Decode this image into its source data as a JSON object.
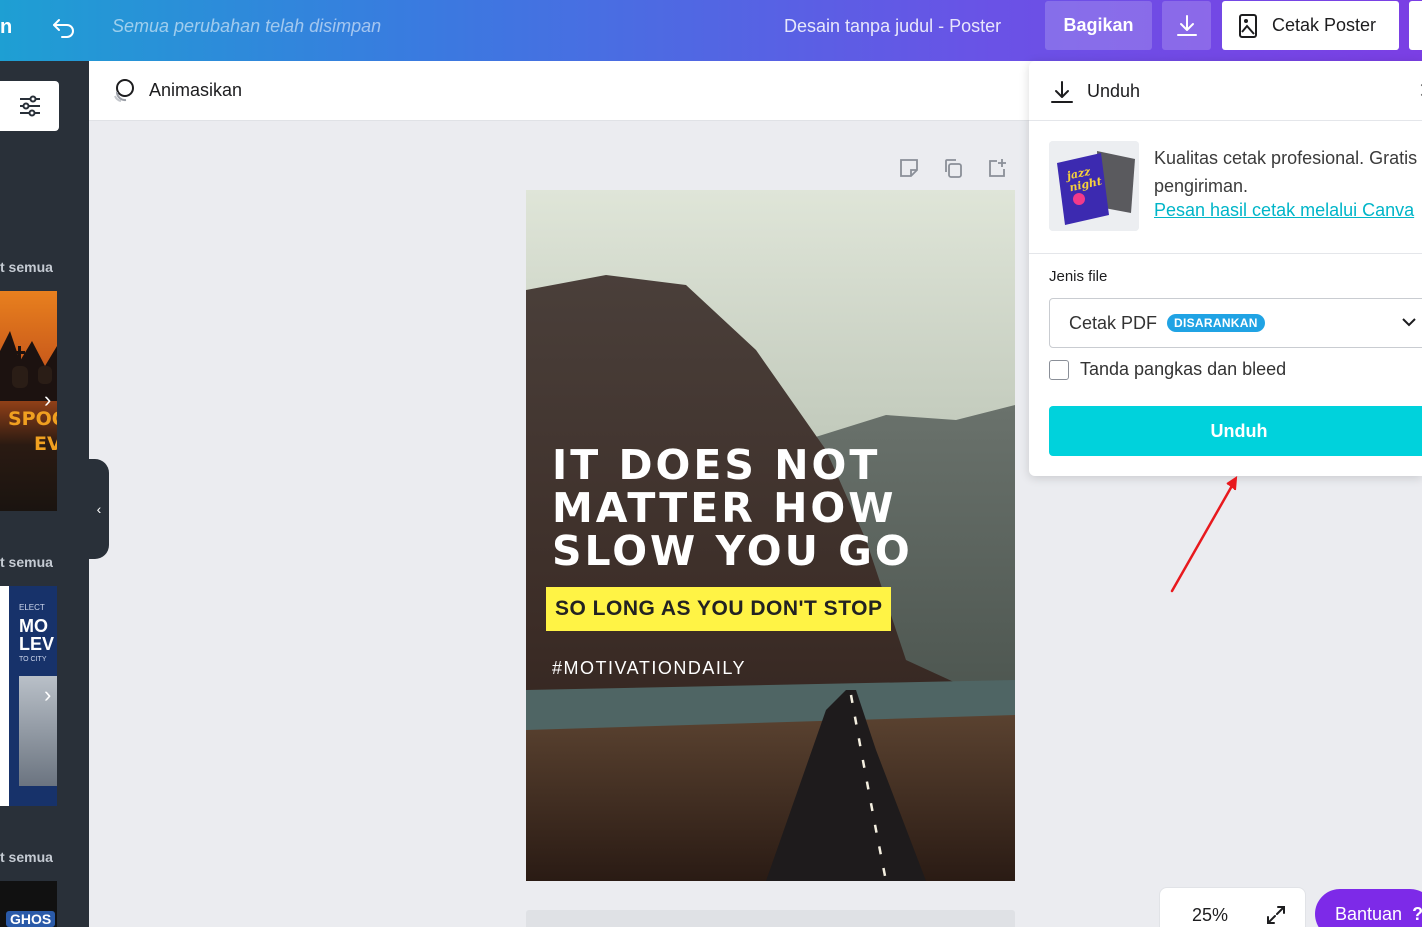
{
  "topbar": {
    "edge_text": "n",
    "saved_status": "Semua perubahan telah disimpan",
    "doc_title": "Desain tanpa judul - Poster",
    "share_label": "Bagikan",
    "print_label": "Cetak Poster"
  },
  "leftpanel": {
    "see_all_1": "t semua",
    "see_all_2": "t semua",
    "see_all_3": "t semua",
    "thumb1_text": "SPOO",
    "thumb1_text2": "EV",
    "thumb2_text_a": "ELECT",
    "thumb2_text_b": "MO",
    "thumb2_text_c": "LEV",
    "thumb2_text_d": "TO CITY",
    "thumb3_text": "GHOS"
  },
  "toolbar": {
    "animate_label": "Animasikan"
  },
  "poster": {
    "headline_1": "IT DOES NOT",
    "headline_2": "MATTER HOW",
    "headline_3": "SLOW YOU GO",
    "subline": "SO LONG AS YOU DON'T STOP",
    "hashtag": "#MOTIVATIONDAILY"
  },
  "download_panel": {
    "title": "Unduh",
    "promo_text": "Kualitas cetak profesional. Gratis pengiriman.",
    "promo_link": "Pesan hasil cetak melalui Canva",
    "promo_img_text": "jazz night",
    "file_type_label": "Jenis file",
    "file_type_value": "Cetak PDF",
    "file_type_badge": "DISARANKAN",
    "crop_marks_label": "Tanda pangkas dan bleed",
    "crop_marks_checked": false,
    "download_button": "Unduh"
  },
  "footer": {
    "zoom": "25%",
    "help_label": "Bantuan",
    "help_icon": "?"
  },
  "colors": {
    "accent_teal": "#00d2dc",
    "link": "#00b5c8",
    "badge": "#20a3e4",
    "help_purple": "#7d2ae8",
    "arrow_red": "#e8191e"
  }
}
